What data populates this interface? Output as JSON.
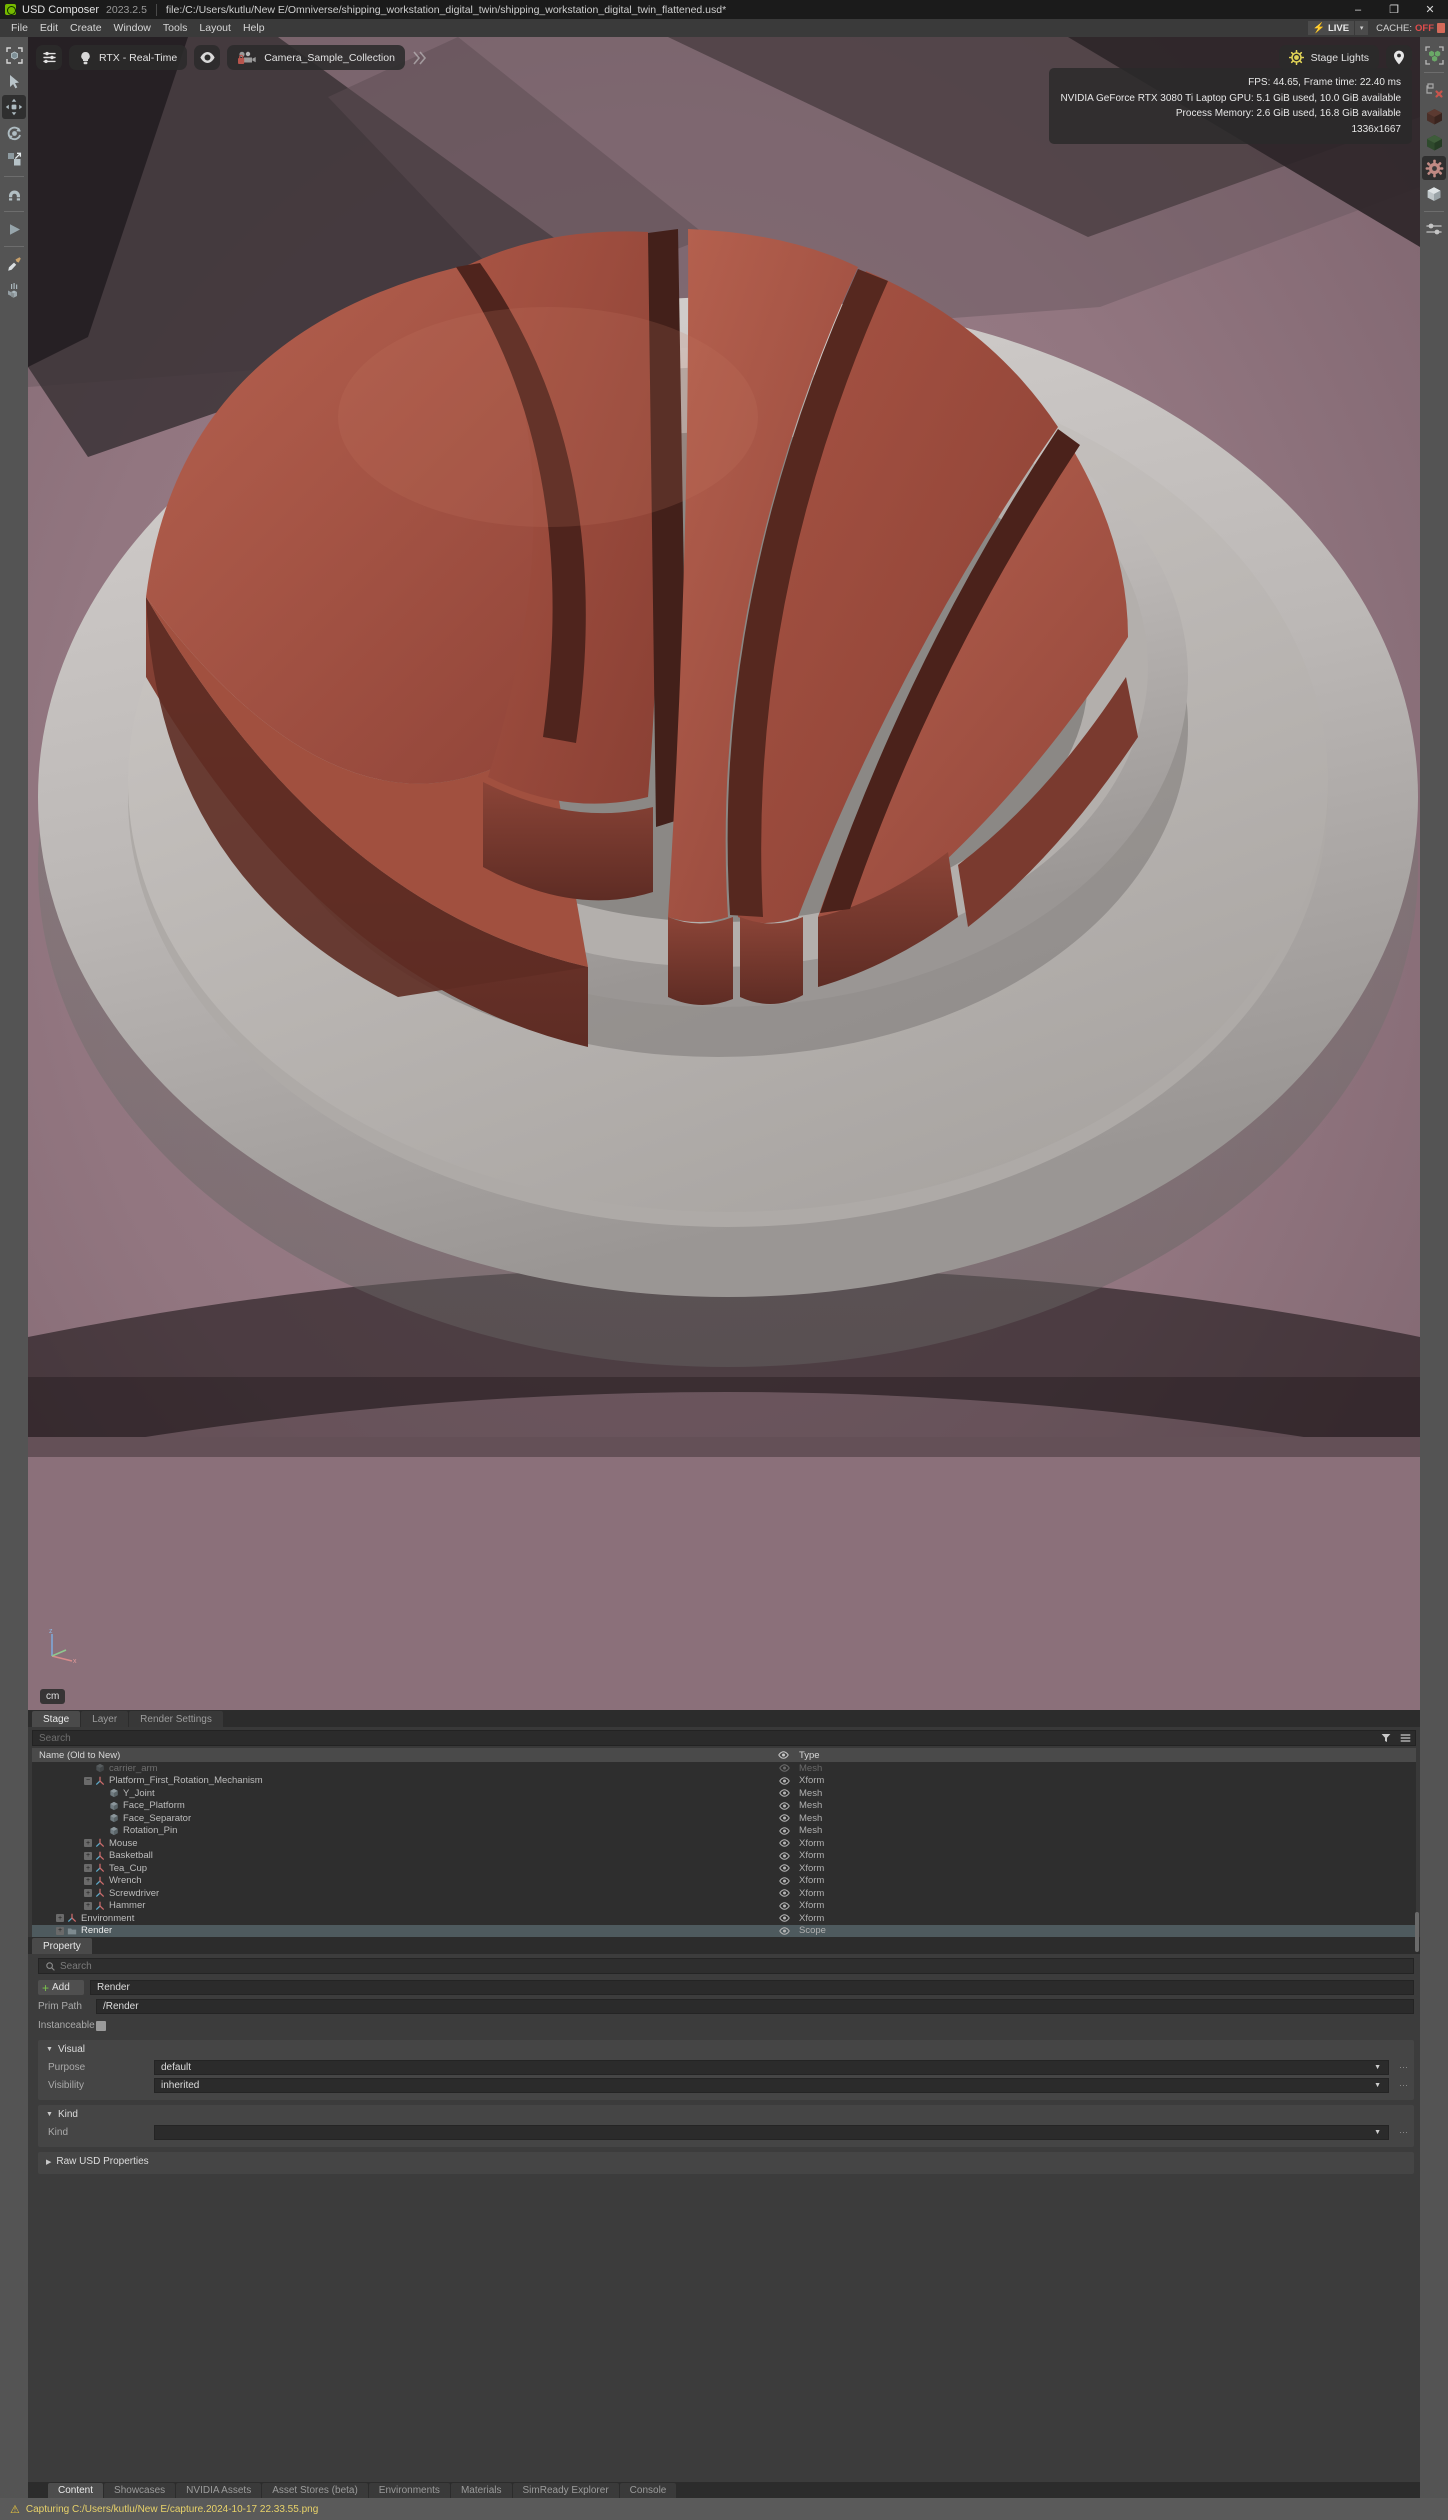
{
  "titlebar": {
    "app_name": "USD Composer",
    "version": "2023.2.5",
    "file_path": "file:/C:/Users/kutlu/New E/Omniverse/shipping_workstation_digital_twin/shipping_workstation_digital_twin_flattened.usd*",
    "minimize": "–",
    "maximize": "❐",
    "close": "✕",
    "logo_icon": "nvidia-omniverse-logo"
  },
  "menubar": {
    "items": [
      "File",
      "Edit",
      "Create",
      "Window",
      "Tools",
      "Layout",
      "Help"
    ],
    "live_label": "LIVE",
    "live_bolt": "⚡",
    "live_caret": "▾",
    "cache_label": "CACHE:",
    "cache_value": "OFF"
  },
  "left_rail": {
    "items": [
      {
        "name": "select-bounds-tool",
        "icon": "selection-box-icon"
      },
      {
        "name": "select-tool",
        "icon": "cursor-arrow-icon"
      },
      {
        "name": "move-tool",
        "icon": "move-gizmo-icon",
        "active": true
      },
      {
        "name": "rotate-tool",
        "icon": "rotate-gizmo-icon"
      },
      {
        "name": "scale-tool",
        "icon": "scale-gizmo-icon"
      },
      {
        "name": "snap-tool",
        "icon": "magnet-snap-icon"
      },
      {
        "name": "play-tool",
        "icon": "play-triangle-icon"
      },
      {
        "name": "paint-tool",
        "icon": "paint-brush-icon"
      },
      {
        "name": "physics-drop-tool",
        "icon": "drop-to-ground-icon"
      }
    ]
  },
  "right_rail": {
    "items": [
      {
        "name": "bounding-box-display",
        "icon": "bounding-cubes-icon"
      },
      {
        "name": "clear-selection",
        "icon": "node-with-x-icon"
      },
      {
        "name": "material-brown",
        "icon": "brown-cube-icon"
      },
      {
        "name": "material-green",
        "icon": "green-cube-icon"
      },
      {
        "name": "physics-settings",
        "icon": "gear-pink-icon",
        "active": true
      },
      {
        "name": "rigid-body",
        "icon": "white-cube-icon"
      },
      {
        "name": "joint-settings",
        "icon": "sliders-joint-icon"
      }
    ]
  },
  "viewport": {
    "render_mode": "RTX - Real-Time",
    "camera": "Camera_Sample_Collection",
    "lighting": "Stage Lights",
    "settings_icon": "sliders-settings-icon",
    "renderer_icon": "lightbulb-icon",
    "visibility_icon": "eye-icon",
    "camera_icon": "locked-camera-icon",
    "chevrons_icon": "double-chevron-right-icon",
    "light_icon": "sun-icon",
    "marker_icon": "map-pin-icon",
    "stats": [
      "FPS: 44.65, Frame time: 22.40 ms",
      "NVIDIA GeForce RTX 3080 Ti Laptop GPU: 5.1 GiB used, 10.0 GiB available",
      "Process Memory: 2.6 GiB used, 16.8 GiB available",
      "1336x1667"
    ],
    "unit": "cm",
    "axis_icon": "axis-gizmo-icon",
    "scene_description": "Basketball 3D model split into wedge slices on a grey rotating platform, mauve floor"
  },
  "stage": {
    "tabs": [
      {
        "label": "Stage",
        "active": true
      },
      {
        "label": "Layer",
        "active": false
      },
      {
        "label": "Render Settings",
        "active": false
      }
    ],
    "search_placeholder": "Search",
    "filter_icon": "funnel-filter-icon",
    "options_icon": "hamburger-options-icon",
    "columns": {
      "name": "Name (Old to New)",
      "type": "Type"
    },
    "rows": [
      {
        "label": "carrier_arm",
        "type": "Mesh",
        "depth": 3,
        "expander": "none",
        "icon": "mesh-cube-icon",
        "clipped": true,
        "selected": false
      },
      {
        "label": "Platform_First_Rotation_Mechanism",
        "type": "Xform",
        "depth": 3,
        "expander": "minus",
        "icon": "xform-axis-icon",
        "selected": false
      },
      {
        "label": "Y_Joint",
        "type": "Mesh",
        "depth": 4,
        "expander": "none",
        "icon": "mesh-cube-icon",
        "selected": false
      },
      {
        "label": "Face_Platform",
        "type": "Mesh",
        "depth": 4,
        "expander": "none",
        "icon": "mesh-cube-icon",
        "selected": false
      },
      {
        "label": "Face_Separator",
        "type": "Mesh",
        "depth": 4,
        "expander": "none",
        "icon": "mesh-cube-icon",
        "selected": false
      },
      {
        "label": "Rotation_Pin",
        "type": "Mesh",
        "depth": 4,
        "expander": "none",
        "icon": "mesh-cube-icon",
        "selected": false
      },
      {
        "label": "Mouse",
        "type": "Xform",
        "depth": 3,
        "expander": "plus",
        "icon": "xform-axis-icon",
        "selected": false
      },
      {
        "label": "Basketball",
        "type": "Xform",
        "depth": 3,
        "expander": "plus",
        "icon": "xform-axis-icon",
        "selected": false
      },
      {
        "label": "Tea_Cup",
        "type": "Xform",
        "depth": 3,
        "expander": "plus",
        "icon": "xform-axis-icon",
        "selected": false
      },
      {
        "label": "Wrench",
        "type": "Xform",
        "depth": 3,
        "expander": "plus",
        "icon": "xform-axis-icon",
        "selected": false
      },
      {
        "label": "Screwdriver",
        "type": "Xform",
        "depth": 3,
        "expander": "plus",
        "icon": "xform-axis-icon",
        "selected": false
      },
      {
        "label": "Hammer",
        "type": "Xform",
        "depth": 3,
        "expander": "plus",
        "icon": "xform-axis-icon",
        "selected": false
      },
      {
        "label": "Environment",
        "type": "Xform",
        "depth": 1,
        "expander": "plus",
        "icon": "xform-axis-icon",
        "selected": false
      },
      {
        "label": "Render",
        "type": "Scope",
        "depth": 1,
        "expander": "plus",
        "icon": "scope-folder-icon",
        "selected": true
      }
    ],
    "eye_icon": "eye-visibility-icon"
  },
  "property": {
    "tab_label": "Property",
    "search_placeholder": "Search",
    "search_icon": "magnifier-icon",
    "add_label": "Add",
    "prim_name": "Render",
    "prim_path_label": "Prim Path",
    "prim_path_value": "/Render",
    "instanceable_label": "Instanceable",
    "instanceable_checked": false,
    "sections": [
      {
        "title": "Visual",
        "expanded": true,
        "rows": [
          {
            "label": "Purpose",
            "value": "default",
            "type": "dropdown"
          },
          {
            "label": "Visibility",
            "value": "inherited",
            "type": "dropdown"
          }
        ]
      },
      {
        "title": "Kind",
        "expanded": true,
        "rows": [
          {
            "label": "Kind",
            "value": "",
            "type": "dropdown"
          }
        ]
      },
      {
        "title": "Raw USD Properties",
        "expanded": false,
        "rows": []
      }
    ]
  },
  "bottom_tabs": [
    {
      "label": "Content",
      "active": true
    },
    {
      "label": "Showcases",
      "active": false
    },
    {
      "label": "NVIDIA Assets",
      "active": false
    },
    {
      "label": "Asset Stores (beta)",
      "active": false
    },
    {
      "label": "Environments",
      "active": false
    },
    {
      "label": "Materials",
      "active": false
    },
    {
      "label": "SimReady Explorer",
      "active": false
    },
    {
      "label": "Console",
      "active": false
    }
  ],
  "statusbar": {
    "warning_icon": "warning-triangle-icon",
    "message": "Capturing C:/Users/kutlu/New E/capture.2024-10-17 22.33.55.png"
  },
  "colors": {
    "accent_green": "#76b900",
    "status_yellow": "#e8d26a",
    "cache_red": "#e04c4c",
    "selection_blue": "#4e5a5e",
    "panel_bg": "#3c3c3c"
  }
}
